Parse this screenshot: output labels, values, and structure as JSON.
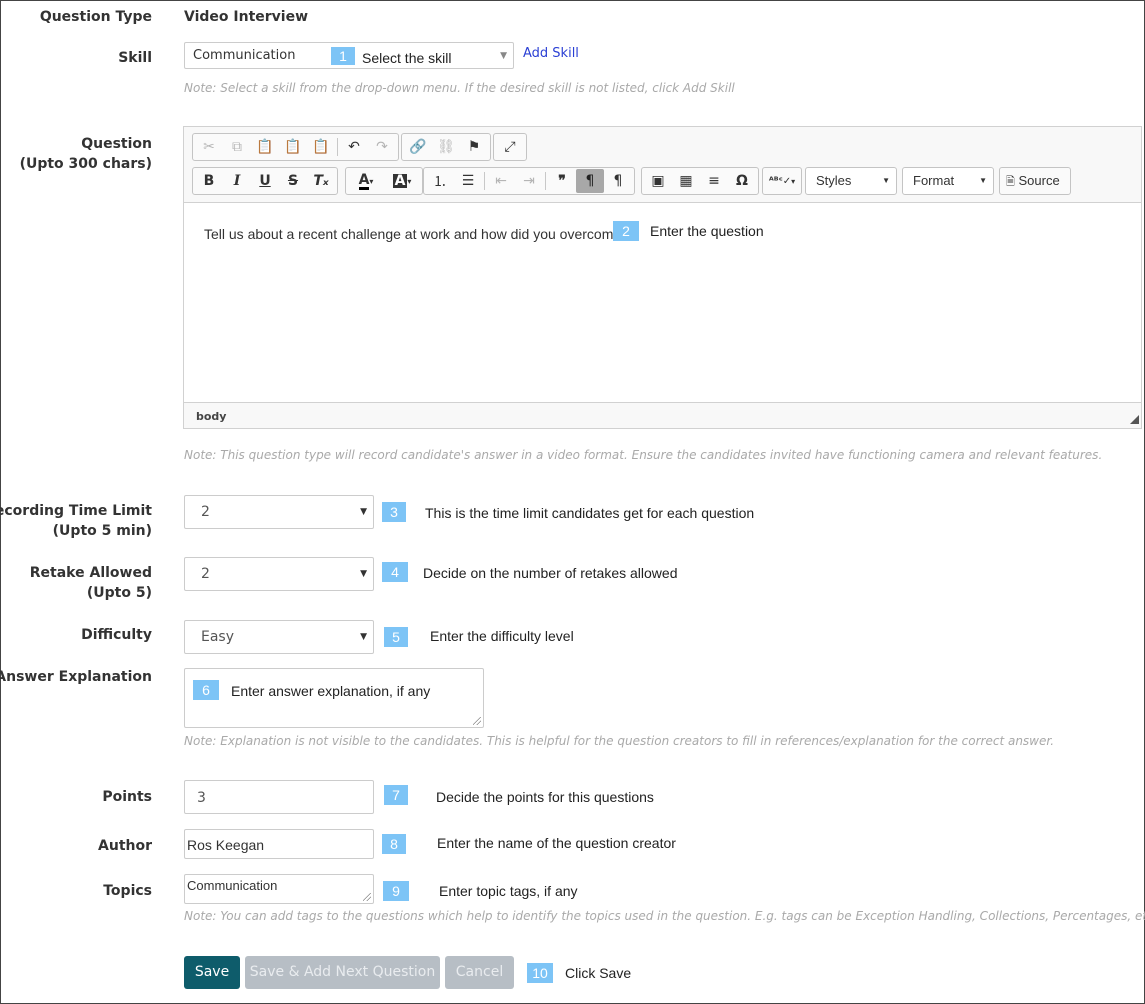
{
  "form": {
    "question_type": {
      "label": "Question Type",
      "value": "Video Interview"
    },
    "skill": {
      "label": "Skill",
      "value": "Communication",
      "hint_badge": "1",
      "hint": "Select the skill",
      "add_link": "Add Skill",
      "note": "Note: Select a skill from the drop-down menu. If the desired skill is not listed, click Add Skill"
    },
    "question": {
      "label_line1": "Question",
      "label_line2": "(Upto 300 chars)",
      "text": "Tell us about a recent challenge at work and how did you overcome it.",
      "badge": "2",
      "hint": "Enter the question",
      "status_path": "body",
      "note": "Note: This question type will record candidate's answer in a video format. Ensure the candidates invited have functioning camera and relevant features."
    },
    "recording_time": {
      "label_line1": "Recording Time Limit",
      "label_line2": "(Upto 5 min)",
      "value": "2",
      "badge": "3",
      "hint": "This is the time limit candidates get for each question"
    },
    "retake": {
      "label_line1": "Retake Allowed",
      "label_line2": "(Upto 5)",
      "value": "2",
      "badge": "4",
      "hint": "Decide on the number of retakes allowed"
    },
    "difficulty": {
      "label": "Difficulty",
      "value": "Easy",
      "badge": "5",
      "hint": "Enter the difficulty level"
    },
    "answer_explanation": {
      "label": "Answer Explanation",
      "badge": "6",
      "hint": "Enter answer explanation, if any",
      "note": "Note: Explanation is not visible to the candidates. This is helpful for the question creators to fill in references/explanation for the correct answer."
    },
    "points": {
      "label": "Points",
      "value": "3",
      "badge": "7",
      "hint": "Decide the points for this questions"
    },
    "author": {
      "label": "Author",
      "value": "Ros Keegan",
      "badge": "8",
      "hint": "Enter the name of the question creator"
    },
    "topics": {
      "label": "Topics",
      "value": "Communication",
      "badge": "9",
      "hint": "Enter topic tags, if any",
      "note": "Note: You can add tags to the questions which help to identify the topics used in the question. E.g. tags can be Exception Handling, Collections, Percentages, etc."
    }
  },
  "toolbar": {
    "styles_label": "Styles",
    "format_label": "Format",
    "source_label": "Source"
  },
  "actions": {
    "save": "Save",
    "save_next": "Save & Add Next Question",
    "cancel": "Cancel",
    "badge": "10",
    "hint": "Click Save"
  },
  "colors": {
    "primary_button": "#0e5c6b",
    "disabled_button": "#b7bec5",
    "badge": "#7dc4f6",
    "link": "#2a3fd4",
    "note": "#a9a9a9"
  }
}
